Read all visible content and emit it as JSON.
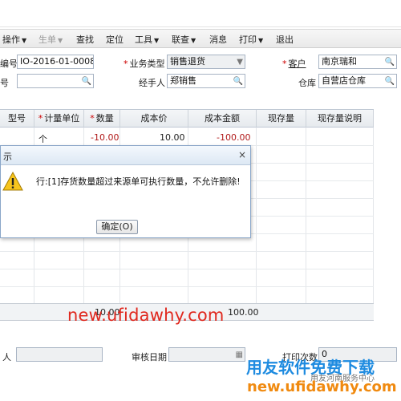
{
  "toolbar": {
    "items": [
      {
        "label": "操作",
        "caret": "▼",
        "enabled": true
      },
      {
        "label": "生单",
        "caret": "▼",
        "enabled": false
      },
      {
        "label": "查找",
        "caret": "",
        "enabled": true
      },
      {
        "label": "定位",
        "caret": "",
        "enabled": true
      },
      {
        "label": "工具",
        "caret": "▼",
        "enabled": true
      },
      {
        "label": "联查",
        "caret": "▼",
        "enabled": true
      },
      {
        "label": "消息",
        "caret": "",
        "enabled": true
      },
      {
        "label": "打印",
        "caret": "▼",
        "enabled": true
      },
      {
        "label": "退出",
        "caret": "",
        "enabled": true
      }
    ]
  },
  "form": {
    "doc_no_label": "编号",
    "doc_no_value": "IO-2016-01-0008",
    "biz_type_label": "业务类型",
    "biz_type_value": "销售退货",
    "customer_label": "客户",
    "customer_value": "南京瑞和",
    "row2_label": "号",
    "row2_value": "",
    "handler_label": "经手人",
    "handler_value": "郑销售",
    "warehouse_label": "仓库",
    "warehouse_value": "自营店仓库",
    "required_mark": "*"
  },
  "grid": {
    "columns": [
      "型号",
      "计量单位",
      "数量",
      "成本价",
      "成本金额",
      "现存量",
      "现存量说明"
    ],
    "rows": [
      {
        "unit": "个",
        "qty": "-10.00",
        "price": "10.00",
        "amount": "-100.00"
      }
    ],
    "totals": {
      "qty": "10.00",
      "amount": "100.00"
    }
  },
  "dialog": {
    "title": "示",
    "close": "×",
    "message": "行:[1]存货数量超过来源单可执行数量，不允许删除!",
    "ok_label": "确定(O)"
  },
  "footer": {
    "maker_label": "人",
    "audit_date_label": "审核日期",
    "print_count_label": "打印次数",
    "print_count_value": "0"
  },
  "watermarks": {
    "url_red": "new.ufidawhy.com",
    "brand_blue": "用友软件免费下载",
    "small_gray": "用友河南服务中心",
    "url_orange": "new.ufidawhy.com"
  },
  "colors": {
    "negative": "#b01818",
    "watermark_red": "#e0281e",
    "watermark_blue": "#1e8be0",
    "watermark_orange": "#f08a10"
  }
}
